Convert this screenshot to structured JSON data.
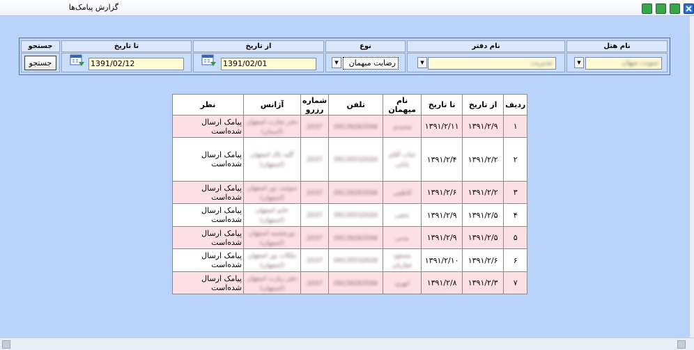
{
  "window": {
    "title": "گزارش پیامک‌ها"
  },
  "filters": {
    "hotel": {
      "label": "نام هتل",
      "value": "سویت میهان"
    },
    "office": {
      "label": "نام دفتر",
      "value": "مدیریت"
    },
    "type": {
      "label": "نوع",
      "value": "رضایت میهمان"
    },
    "from": {
      "label": "از تاریخ",
      "value": "1391/02/01"
    },
    "to": {
      "label": "تا تاریخ",
      "value": "1391/02/12"
    },
    "search": {
      "label": "جستجو",
      "button": "جستجو"
    }
  },
  "table": {
    "headers": {
      "rad": "ردیف",
      "from": "از تاریخ",
      "to": "تا تاریخ",
      "guest": "نام میهمان",
      "tel": "تلفن",
      "reserve": "شماره رزرو",
      "agency": "آژانس",
      "opinion": "نظر"
    },
    "rows": [
      {
        "rad": "۱",
        "from": "۱۳۹۱/۲/۹",
        "to": "۱۳۹۱/۲/۱۱",
        "guest": "محمدی",
        "tel": "09139283594",
        "reserve": "2037",
        "agency": "دفتر تجارت اصفهان (آسمان)",
        "opinion": "پیامک ارسال شده‌است"
      },
      {
        "rad": "۲",
        "from": "۱۳۹۱/۲/۲",
        "to": "۱۳۹۱/۲/۴",
        "guest": "جناب آقای بابایی",
        "tel": "09135532020",
        "reserve": "2037",
        "agency": "گلبه تاک اصفهان (اصفهان)",
        "opinion": "پیامک ارسال شده‌است"
      },
      {
        "rad": "۳",
        "from": "۱۳۹۱/۲/۲",
        "to": "۱۳۹۱/۲/۶",
        "guest": "کاظمی",
        "tel": "09139283594",
        "reserve": "2037",
        "agency": "سوئیت نور اصفهان (اصفهان)",
        "opinion": "پیامک ارسال شده‌است"
      },
      {
        "rad": "۴",
        "from": "۱۳۹۱/۲/۵",
        "to": "۱۳۹۱/۲/۹",
        "guest": "نجفی",
        "tel": "09135532020",
        "reserve": "2037",
        "agency": "خانم اصفهان (اصفهان)",
        "opinion": "پیامک ارسال شده‌است"
      },
      {
        "rad": "۵",
        "from": "۱۳۹۱/۲/۵",
        "to": "۱۳۹۱/۲/۹",
        "guest": "مدنی",
        "tel": "09139283594",
        "reserve": "2037",
        "agency": "نورچشمه اصفهان (اصفهان)",
        "opinion": "پیامک ارسال شده‌است"
      },
      {
        "rad": "۶",
        "from": "۱۳۹۱/۲/۶",
        "to": "۱۳۹۱/۲/۱۰",
        "guest": "مسعود غفاریان",
        "tel": "09135532020",
        "reserve": "2037",
        "agency": "ملکات نور اصفهان (اصفهان)",
        "opinion": "پیامک ارسال شده‌است"
      },
      {
        "rad": "۷",
        "from": "۱۳۹۱/۲/۳",
        "to": "۱۳۹۱/۲/۸",
        "guest": "ابهری",
        "tel": "09139283594",
        "reserve": "2037",
        "agency": "دفتر زیارت اصفهان (اصفهان)",
        "opinion": "پیامک ارسال شده‌است"
      }
    ]
  }
}
